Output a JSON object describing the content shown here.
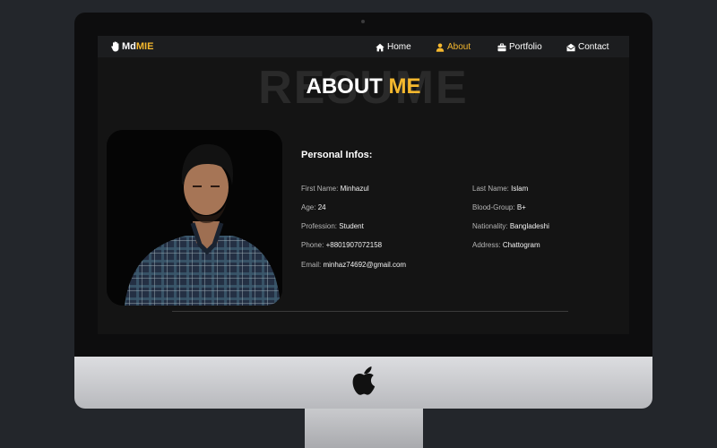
{
  "brand": {
    "prefix": "Md",
    "accent": "MIE"
  },
  "nav": {
    "home": "Home",
    "about": "About",
    "portfolio": "Portfolio",
    "contact": "Contact"
  },
  "hero": {
    "bg_text": "RESUME",
    "title_main": "ABOUT",
    "title_accent": "ME"
  },
  "personal": {
    "heading": "Personal Infos:",
    "first_name": {
      "label": "First Name:",
      "value": "Minhazul"
    },
    "last_name": {
      "label": "Last Name:",
      "value": "Islam"
    },
    "age": {
      "label": "Age:",
      "value": "24"
    },
    "blood_group": {
      "label": "Blood-Group:",
      "value": "B+"
    },
    "profession": {
      "label": "Profession:",
      "value": "Student"
    },
    "nationality": {
      "label": "Nationality:",
      "value": "Bangladeshi"
    },
    "phone": {
      "label": "Phone:",
      "value": "+8801907072158"
    },
    "address": {
      "label": "Address:",
      "value": "Chattogram"
    },
    "email": {
      "label": "Email:",
      "value": "minhaz74692@gmail.com"
    }
  },
  "icons": {
    "brand": "hand-icon",
    "home": "home-icon",
    "about": "user-icon",
    "portfolio": "briefcase-icon",
    "contact": "envelope-open-icon",
    "device": "apple-logo-icon"
  },
  "colors": {
    "accent": "#f5b82e",
    "screen_bg": "#141414",
    "navbar_bg": "#1c1d1f",
    "page_bg": "#23262b"
  }
}
